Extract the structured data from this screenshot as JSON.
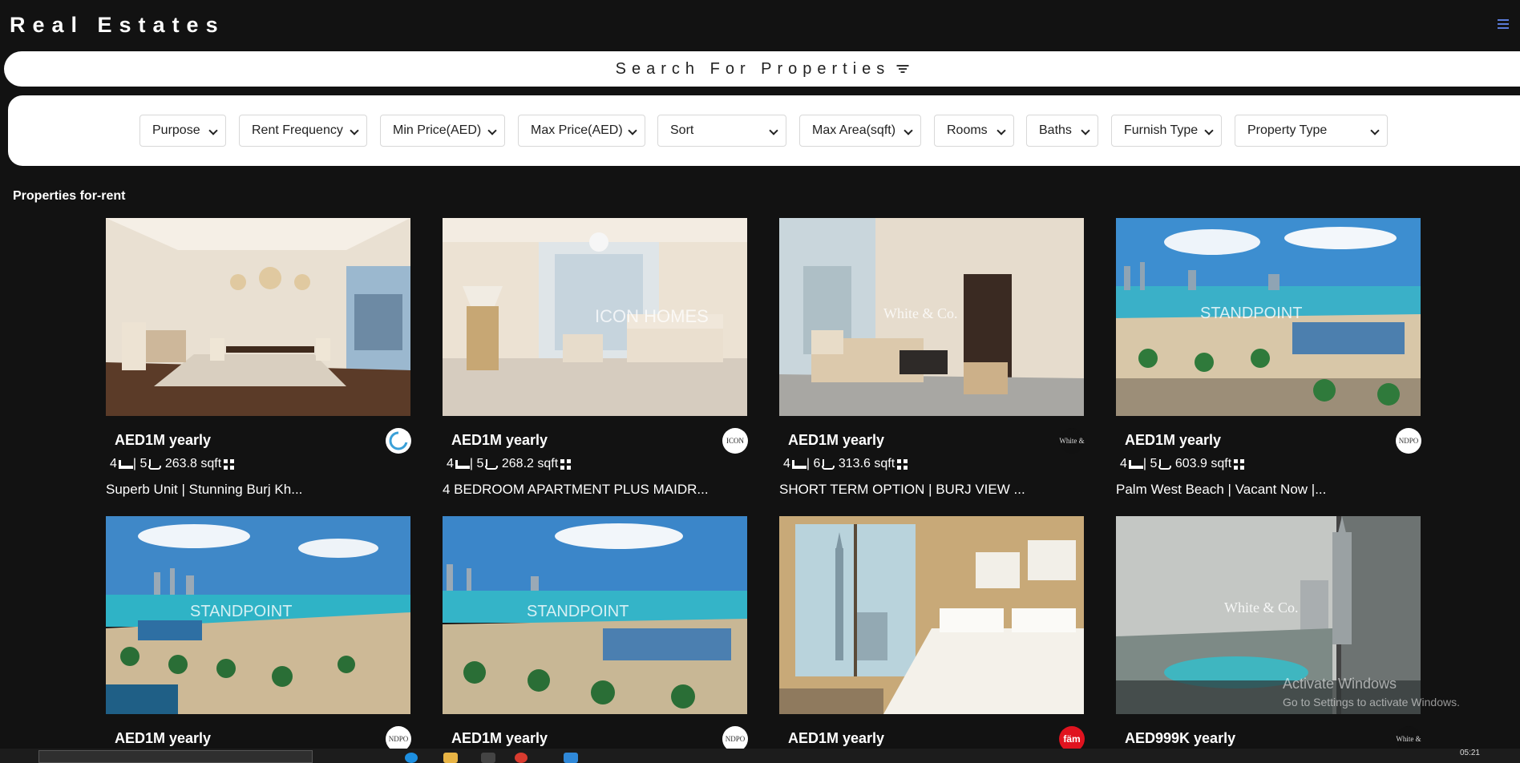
{
  "brand": "Real Estates",
  "search": {
    "label": "Search For Properties"
  },
  "filters": [
    {
      "label": "Purpose"
    },
    {
      "label": "Rent Frequency"
    },
    {
      "label": "Min Price(AED)"
    },
    {
      "label": "Max Price(AED)"
    },
    {
      "label": "Sort"
    },
    {
      "label": "Max Area(sqft)"
    },
    {
      "label": "Rooms"
    },
    {
      "label": "Baths"
    },
    {
      "label": "Furnish Type"
    },
    {
      "label": "Property Type"
    }
  ],
  "section_title": "Properties for-rent",
  "cards": [
    {
      "price": "AED1M yearly",
      "rooms": "4",
      "baths": "5",
      "area": "263.8 sqft",
      "title": "Superb Unit | Stunning Burj Kh...",
      "agency": ""
    },
    {
      "price": "AED1M yearly",
      "rooms": "4",
      "baths": "5",
      "area": "268.2 sqft",
      "title": "4 BEDROOM APARTMENT PLUS MAIDR...",
      "agency": "ICON"
    },
    {
      "price": "AED1M yearly",
      "rooms": "4",
      "baths": "6",
      "area": "313.6 sqft",
      "title": "SHORT TERM OPTION | BURJ VIEW ...",
      "agency": "White & Co."
    },
    {
      "price": "AED1M yearly",
      "rooms": "4",
      "baths": "5",
      "area": "603.9 sqft",
      "title": "Palm West Beach | Vacant Now |...",
      "agency": "NDPO"
    },
    {
      "price": "AED1M yearly",
      "agency": "NDPO"
    },
    {
      "price": "AED1M yearly",
      "agency": "NDPO"
    },
    {
      "price": "AED1M yearly",
      "agency": "fäm"
    },
    {
      "price": "AED999K yearly",
      "agency": "White & Co."
    }
  ],
  "photo_watermarks": [
    "",
    "ICON HOMES",
    "White & Co.",
    "STANDPOINT",
    "STANDPOINT",
    "STANDPOINT",
    "",
    "White & Co."
  ],
  "os": {
    "watermark_title": "Activate Windows",
    "watermark_sub": "Go to Settings to activate Windows.",
    "clock": "05:21"
  },
  "colors": {
    "background": "#121212",
    "panel": "#ffffff",
    "menu_icon": "#5a7bd8"
  }
}
